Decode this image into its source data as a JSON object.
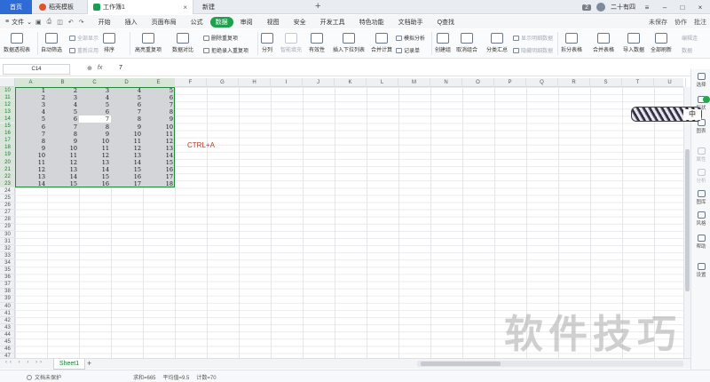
{
  "titlebar": {
    "home_tab": "首页",
    "template_tab": "稻壳模板",
    "doc_tab": "工作簿1",
    "new_tab": "新建",
    "plus": "+",
    "badge": "2",
    "user_name": "二十有四",
    "menu_glyph": "≡",
    "min_glyph": "–",
    "max_glyph": "□",
    "close_glyph": "×"
  },
  "menubar": {
    "file_label": "文件",
    "items": [
      "开始",
      "插入",
      "页面布局",
      "公式",
      "数据",
      "审阅",
      "视图",
      "安全",
      "开发工具",
      "特色功能",
      "文档助手"
    ],
    "active_item": "数据",
    "search_label": "Q查找",
    "unsaved_label": "未保存",
    "collab_label": "协作",
    "comment_label": "批注"
  },
  "ribbon": {
    "pivot": "数据透视表",
    "autofilter": "自动筛选",
    "show_all": "全部显示",
    "reapply": "重新应用",
    "sort": "排序",
    "highlight_dup": "高亮重复项",
    "data_compare": "数据对比",
    "remove_dup": "删除重复项",
    "reject_dup": "拒绝录入重复项",
    "split": "分列",
    "smart_fill": "智能填充",
    "validity": "有效性",
    "dropdown": "插入下拉列表",
    "merge_calc": "合并计算",
    "simulate": "模拟分析",
    "record": "记录单",
    "create_group": "创建组",
    "ungroup": "取消组合",
    "subtotal": "分类汇总",
    "show_detail": "显示明细数据",
    "hide_detail": "隐藏明细数据",
    "split_table": "拆分表格",
    "merge_table": "合并表格",
    "import_data": "导入数据",
    "refresh_all": "全部刷新",
    "edit_link": "编辑连",
    "data_prop": "数据"
  },
  "formulabar": {
    "cell_name": "C14",
    "formula_value": "7"
  },
  "grid": {
    "columns": [
      "A",
      "B",
      "C",
      "D",
      "E",
      "F",
      "G",
      "H",
      "I",
      "J",
      "K",
      "L",
      "M",
      "N",
      "O",
      "P",
      "Q",
      "R",
      "S",
      "T",
      "U"
    ],
    "selected_columns": [
      "A",
      "B",
      "C",
      "D",
      "E"
    ],
    "row_numbers": [
      "10",
      "11",
      "12",
      "13",
      "14",
      "15",
      "16",
      "17",
      "18",
      "19",
      "20",
      "21",
      "22",
      "23",
      "24",
      "25",
      "26",
      "27",
      "28",
      "29",
      "30",
      "31",
      "32",
      "33",
      "34",
      "35",
      "36",
      "37",
      "38",
      "39",
      "40",
      "41",
      "42",
      "43",
      "44",
      "45",
      "46",
      "47"
    ],
    "selected_rows": [
      "10",
      "11",
      "12",
      "13",
      "14",
      "15",
      "16",
      "17",
      "18",
      "19",
      "20",
      "21",
      "22",
      "23"
    ],
    "data_rows": [
      [
        "1",
        "2",
        "3",
        "4",
        "5"
      ],
      [
        "2",
        "3",
        "4",
        "5",
        "6"
      ],
      [
        "3",
        "4",
        "5",
        "6",
        "7"
      ],
      [
        "4",
        "5",
        "6",
        "7",
        "8"
      ],
      [
        "5",
        "6",
        "7",
        "8",
        "9"
      ],
      [
        "6",
        "7",
        "8",
        "9",
        "10"
      ],
      [
        "7",
        "8",
        "9",
        "10",
        "11"
      ],
      [
        "8",
        "9",
        "10",
        "11",
        "12"
      ],
      [
        "9",
        "10",
        "11",
        "12",
        "13"
      ],
      [
        "10",
        "11",
        "12",
        "13",
        "14"
      ],
      [
        "11",
        "12",
        "13",
        "14",
        "15"
      ],
      [
        "12",
        "13",
        "14",
        "15",
        "16"
      ],
      [
        "13",
        "14",
        "15",
        "16",
        "17"
      ],
      [
        "14",
        "15",
        "16",
        "17",
        "18"
      ]
    ],
    "annotation": "CTRL+A"
  },
  "sidebar": {
    "items": [
      "选择",
      "形状",
      "图表",
      "属性",
      "分析",
      "图库",
      "风格",
      "帮助",
      "设置"
    ]
  },
  "ime": {
    "label": "中"
  },
  "sheets": {
    "active": "Sheet1",
    "add": "+"
  },
  "status": {
    "protect_label": "文档未保护",
    "sum_label": "求和=665",
    "avg_label": "平均值=9.5",
    "count_label": "计数=70"
  },
  "watermark": "软件技巧"
}
